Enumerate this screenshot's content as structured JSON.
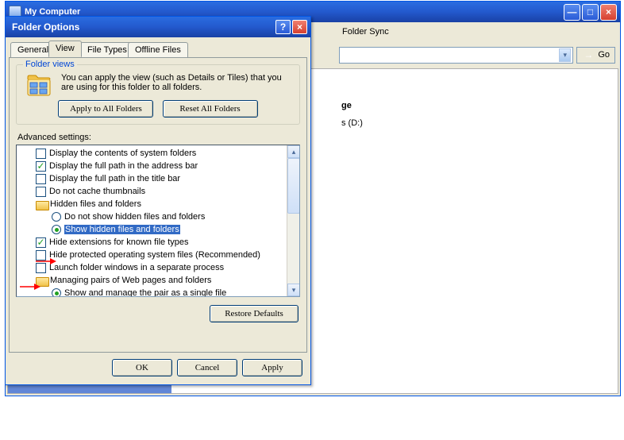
{
  "bg": {
    "title": "My Computer",
    "menu": {
      "foldersync": "Folder Sync"
    },
    "go": "Go",
    "contentHeading": "ge",
    "contentItem": "s (D:)"
  },
  "dialog": {
    "title": "Folder Options",
    "tabs": {
      "general": "General",
      "view": "View",
      "filetypes": "File Types",
      "offline": "Offline Files"
    },
    "folderViews": {
      "title": "Folder views",
      "text": "You can apply the view (such as Details or Tiles) that you are using for this folder to all folders.",
      "applyAll": "Apply to All Folders",
      "resetAll": "Reset All Folders"
    },
    "advLabel": "Advanced settings:",
    "items": [
      {
        "kind": "check",
        "checked": false,
        "indent": 1,
        "label": "Display the contents of system folders"
      },
      {
        "kind": "check",
        "checked": true,
        "indent": 1,
        "label": "Display the full path in the address bar"
      },
      {
        "kind": "check",
        "checked": false,
        "indent": 1,
        "label": "Display the full path in the title bar"
      },
      {
        "kind": "check",
        "checked": false,
        "indent": 1,
        "label": "Do not cache thumbnails"
      },
      {
        "kind": "folder",
        "indent": 1,
        "label": "Hidden files and folders"
      },
      {
        "kind": "radio",
        "checked": false,
        "indent": 2,
        "label": "Do not show hidden files and folders"
      },
      {
        "kind": "radio",
        "checked": true,
        "indent": 2,
        "label": "Show hidden files and folders",
        "selected": true
      },
      {
        "kind": "check",
        "checked": true,
        "indent": 1,
        "label": "Hide extensions for known file types"
      },
      {
        "kind": "check",
        "checked": false,
        "indent": 1,
        "label": "Hide protected operating system files (Recommended)"
      },
      {
        "kind": "check",
        "checked": false,
        "indent": 1,
        "label": "Launch folder windows in a separate process"
      },
      {
        "kind": "folder",
        "indent": 1,
        "label": "Managing pairs of Web pages and folders"
      },
      {
        "kind": "radio",
        "checked": true,
        "indent": 2,
        "label": "Show and manage the pair as a single file"
      }
    ],
    "restore": "Restore Defaults",
    "ok": "OK",
    "cancel": "Cancel",
    "apply": "Apply"
  }
}
